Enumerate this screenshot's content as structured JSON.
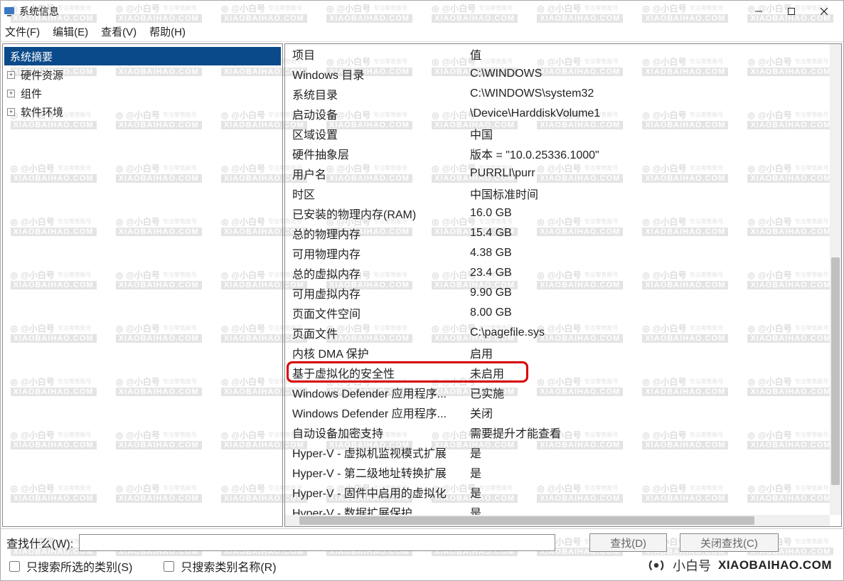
{
  "window": {
    "title": "系统信息"
  },
  "menu": {
    "file": "文件(F)",
    "edit": "编辑(E)",
    "view": "查看(V)",
    "help": "帮助(H)"
  },
  "tree": {
    "summary": "系统摘要",
    "hardware": "硬件资源",
    "components": "组件",
    "software": "软件环境"
  },
  "details": {
    "header_key": "项目",
    "header_value": "值",
    "rows": [
      {
        "k": "Windows 目录",
        "v": "C:\\WINDOWS"
      },
      {
        "k": "系统目录",
        "v": "C:\\WINDOWS\\system32"
      },
      {
        "k": "启动设备",
        "v": "\\Device\\HarddiskVolume1"
      },
      {
        "k": "区域设置",
        "v": "中国"
      },
      {
        "k": "硬件抽象层",
        "v": "版本 = \"10.0.25336.1000\""
      },
      {
        "k": "用户名",
        "v": "PURRLI\\purr"
      },
      {
        "k": "时区",
        "v": "中国标准时间"
      },
      {
        "k": "已安装的物理内存(RAM)",
        "v": "16.0 GB"
      },
      {
        "k": "总的物理内存",
        "v": "15.4 GB"
      },
      {
        "k": "可用物理内存",
        "v": "4.38 GB"
      },
      {
        "k": "总的虚拟内存",
        "v": "23.4 GB"
      },
      {
        "k": "可用虚拟内存",
        "v": "9.90 GB"
      },
      {
        "k": "页面文件空间",
        "v": "8.00 GB"
      },
      {
        "k": "页面文件",
        "v": "C:\\pagefile.sys"
      },
      {
        "k": "内核 DMA 保护",
        "v": "启用"
      },
      {
        "k": "基于虚拟化的安全性",
        "v": "未启用",
        "highlight": true
      },
      {
        "k": "Windows Defender 应用程序...",
        "v": "已实施"
      },
      {
        "k": "Windows Defender 应用程序...",
        "v": "关闭"
      },
      {
        "k": "自动设备加密支持",
        "v": "需要提升才能查看"
      },
      {
        "k": "Hyper-V - 虚拟机监视模式扩展",
        "v": "是"
      },
      {
        "k": "Hyper-V - 第二级地址转换扩展",
        "v": "是"
      },
      {
        "k": "Hyper-V - 固件中启用的虚拟化",
        "v": "是"
      },
      {
        "k": "Hyper-V - 数据扩展保护",
        "v": "是"
      }
    ]
  },
  "search": {
    "label": "查找什么(W):",
    "find_btn": "查找(D)",
    "close_btn": "关闭查找(C)",
    "check1": "只搜索所选的类别(S)",
    "check2": "只搜索类别名称(R)"
  },
  "watermark": {
    "line1": "@小白号",
    "line2": "XIAOBAIHAO.COM",
    "corner1": "小白号",
    "corner2": "XIAOBAIHAO.COM"
  }
}
